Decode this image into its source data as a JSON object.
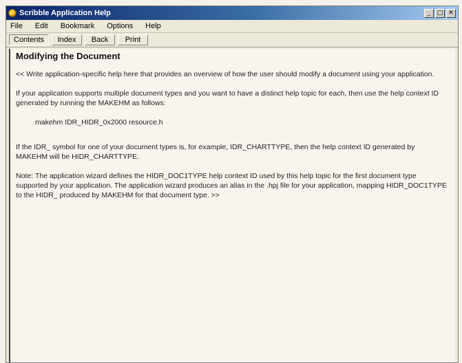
{
  "window": {
    "title": "Scribble Application Help"
  },
  "menubar": {
    "items": [
      "File",
      "Edit",
      "Bookmark",
      "Options",
      "Help"
    ]
  },
  "toolbar": {
    "buttons": [
      "Contents",
      "Index",
      "Back",
      "Print"
    ]
  },
  "content": {
    "heading": "Modifying the Document",
    "paragraphs": [
      "<< Write application-specific help here that provides an overview of how the user should modify a document using your application.",
      "If your application supports multiple document types and you want to have a distinct help topic for each, then use the help context ID generated by running the MAKEHM as follows:",
      "makehm IDR_HIDR_0x2000 resource.h",
      "If the IDR_ symbol for one of your document types is, for example, IDR_CHARTTYPE, then the help context ID generated by MAKEHM will be HIDR_CHARTTYPE.",
      "Note: The application wizard defines the HIDR_DOC1TYPE help context ID used by this help topic for the first document type supported by your application. The application wizard produces an alias in the .hpj file for your application, mapping HIDR_DOC1TYPE to the HIDR_ produced by MAKEHM for that document type. >>"
    ]
  }
}
